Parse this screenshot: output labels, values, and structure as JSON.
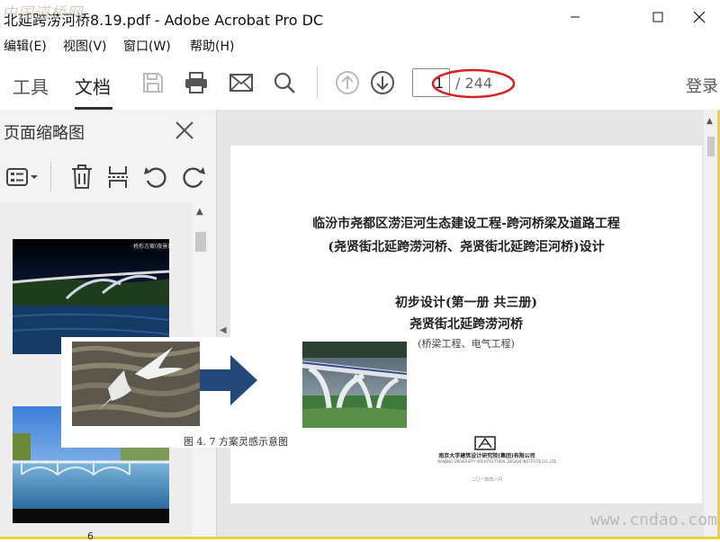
{
  "window": {
    "title": "北延跨涝河桥8.19.pdf - Adobe Acrobat Pro DC",
    "watermark_top": "中国道桥网",
    "minimize_icon": "minimize-icon",
    "maximize_icon": "maximize-icon",
    "close_icon": "close-icon"
  },
  "menu": [
    "编辑(E)",
    "视图(V)",
    "窗口(W)",
    "帮助(H)"
  ],
  "toolbar": {
    "tabs": [
      "工具",
      "文档"
    ],
    "active_tab": "文档",
    "icons": [
      "save-icon",
      "print-icon",
      "email-icon",
      "search-icon",
      "page-up-icon",
      "page-down-icon"
    ],
    "page_number": "1",
    "page_total": "/ 244",
    "login": "登录",
    "highlight_color": "#d92121"
  },
  "sidebar": {
    "title": "页面缩略图",
    "close_icon": "close-icon",
    "tools": [
      "options-icon",
      "delete-icon",
      "extract-icon",
      "undo-icon",
      "redo-icon"
    ],
    "thumb_caption": "桥形方案(夜景)",
    "thumb_number": "6"
  },
  "document": {
    "title_line1": "临汾市尧都区涝洰河生态建设工程-跨河桥梁及道路工程",
    "title_line2": "(尧贤街北延跨涝河桥、尧贤街北延跨洰河桥)设计",
    "volume": "初步设计(第一册 共三册)",
    "bridge_name": "尧贤街北延跨涝河桥",
    "subtitle": "(桥梁工程、电气工程)",
    "institute": "南京大学建筑设计研究院(集团)有限公司",
    "institute_en": "NANJING UNIVERSITY ARCHITECTURAL DESIGN INSTITUTE CO.,LTD",
    "date": "二〇一四年八月"
  },
  "overlay": {
    "caption": "图 4. 7 方案灵感示意图",
    "arrow_color": "#23487a"
  },
  "watermark_bottom": "www.cndao.com",
  "colors": {
    "frame_border": "#e8d33a",
    "toolbar_bg": "#ffffff",
    "sidebar_bg": "#f3f3f3",
    "doc_bg": "#e6e6e6"
  }
}
